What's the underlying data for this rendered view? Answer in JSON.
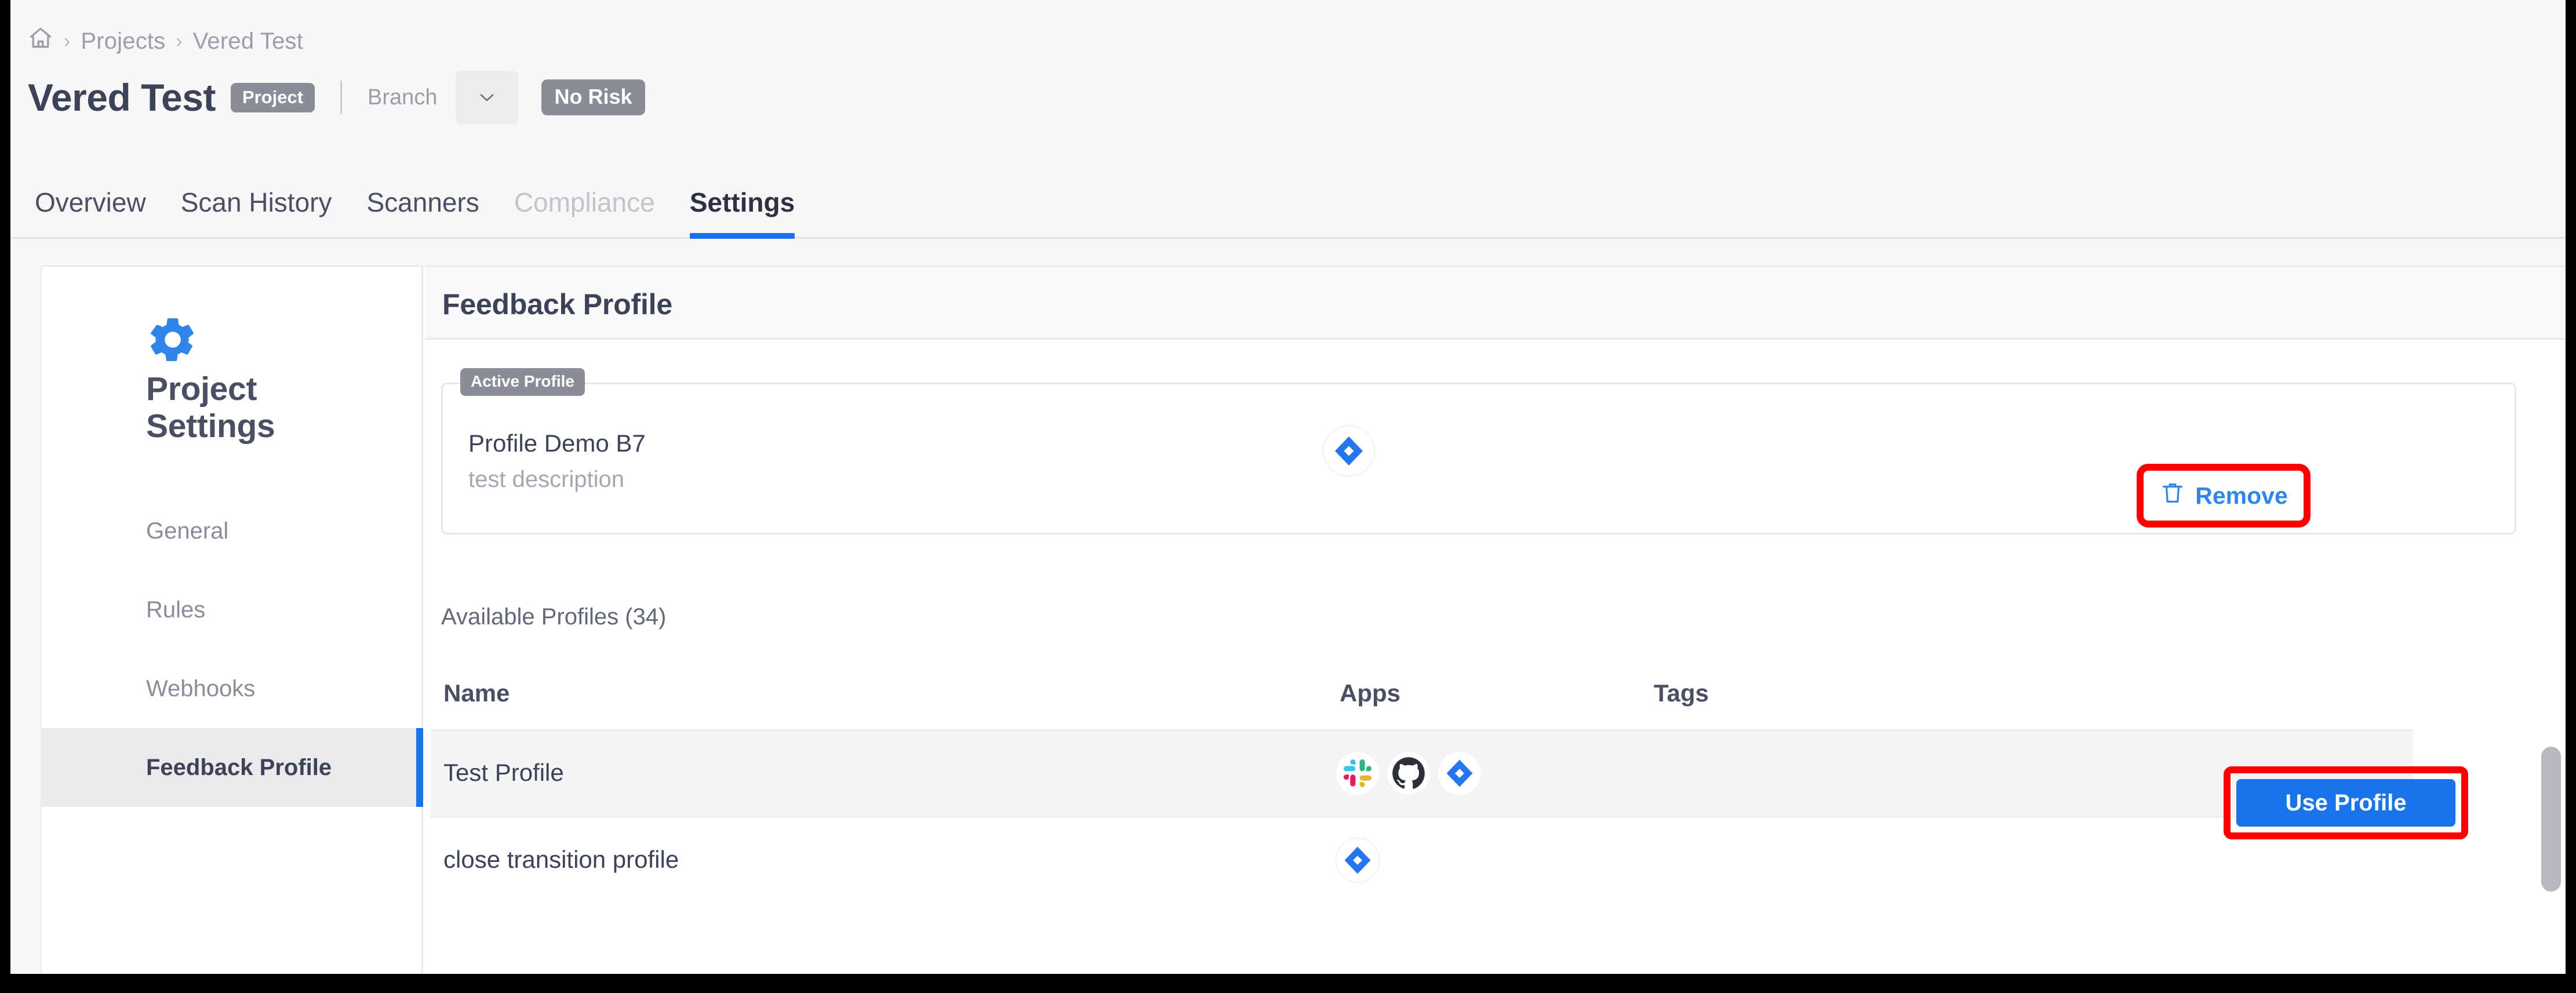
{
  "breadcrumb": {
    "home_icon": "home-icon",
    "separator": "›",
    "items": [
      {
        "label": "Projects"
      },
      {
        "label": "Vered Test"
      }
    ]
  },
  "header": {
    "title": "Vered Test",
    "type_pill": "Project",
    "branch_label": "Branch",
    "branch_caret": "⌄",
    "risk_pill": "No Risk"
  },
  "tabs": [
    {
      "label": "Overview",
      "state": "normal"
    },
    {
      "label": "Scan History",
      "state": "normal"
    },
    {
      "label": "Scanners",
      "state": "normal"
    },
    {
      "label": "Compliance",
      "state": "disabled"
    },
    {
      "label": "Settings",
      "state": "active"
    }
  ],
  "sidebar": {
    "gear_icon": "gear-icon",
    "heading": "Project Settings",
    "items": [
      {
        "label": "General",
        "selected": false
      },
      {
        "label": "Rules",
        "selected": false
      },
      {
        "label": "Webhooks",
        "selected": false
      },
      {
        "label": "Feedback Profile",
        "selected": true
      }
    ]
  },
  "main": {
    "section_title": "Feedback Profile",
    "active_profile": {
      "badge": "Active Profile",
      "name": "Profile Demo B7",
      "description": "test description",
      "apps": [
        "jira-icon"
      ],
      "remove_label": "Remove",
      "remove_icon": "trash-icon"
    },
    "available_label": "Available Profiles (34)",
    "table": {
      "columns": [
        "Name",
        "Apps",
        "Tags"
      ],
      "rows": [
        {
          "name": "Test Profile",
          "apps": [
            "slack-icon",
            "github-icon",
            "jira-icon"
          ],
          "tags": "",
          "action_label": "Use Profile",
          "highlighted": true
        },
        {
          "name": "close transition profile",
          "apps": [
            "jira-icon"
          ],
          "tags": "",
          "action_label": "",
          "highlighted": false
        }
      ]
    }
  },
  "colors": {
    "accent_blue": "#1a73e8",
    "link_blue": "#2f86e8",
    "highlight_red": "#ff0000",
    "pill_gray": "#8a8c97",
    "text_dark": "#3c4257",
    "text_muted": "#9b9eaa"
  }
}
